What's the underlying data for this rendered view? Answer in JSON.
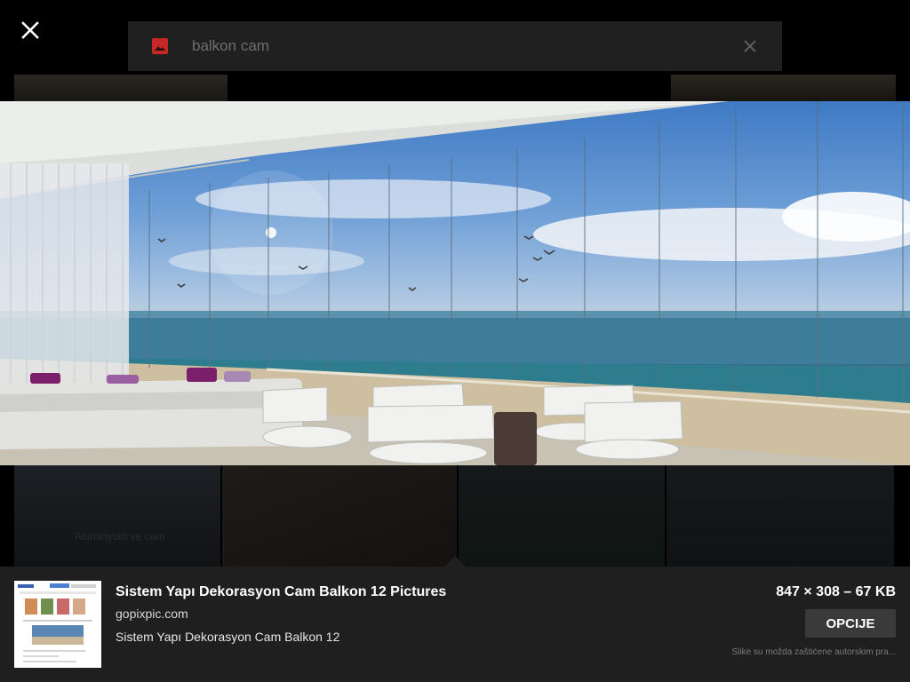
{
  "search": {
    "query": "balkon cam"
  },
  "background": {
    "caption": "Aluminyum ve cam"
  },
  "details": {
    "title": "Sistem Yapı Dekorasyon Cam Balkon 12 Pictures",
    "domain": "gopixpic.com",
    "description": "Sistem Yapı Dekorasyon Cam Balkon 12",
    "dimensions": "847 × 308 – 67 KB",
    "options_label": "OPCIJE",
    "copyright_notice": "Slike su možda zaštićene autorskim pra..."
  },
  "icons": {
    "close": "close-icon",
    "search_type": "image-icon",
    "clear": "clear-icon"
  },
  "colors": {
    "panel_bg": "#1f1f1f",
    "search_bar_bg": "#202020",
    "image_icon": "#e53935"
  }
}
